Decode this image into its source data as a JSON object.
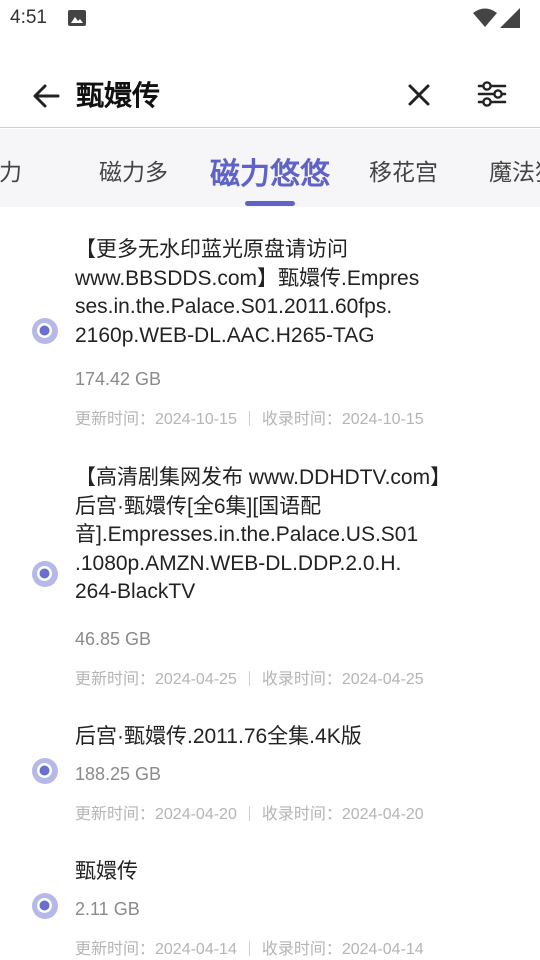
{
  "status_bar": {
    "time": "4:51"
  },
  "search": {
    "query": "甄嬛传"
  },
  "tabs": [
    {
      "label": "磁力"
    },
    {
      "label": "磁力多"
    },
    {
      "label": "磁力悠悠"
    },
    {
      "label": "移花宫"
    },
    {
      "label": "魔法猫"
    }
  ],
  "active_tab": 2,
  "accent_color": "#5f63c8",
  "results": [
    {
      "title_lines": [
        "【更多无水印蓝光原盘请访问",
        "www.BBSDDS.com】甄嬛传.Empres",
        "ses.in.the.Palace.S01.2011.60fps.",
        "2160p.WEB-DL.AAC.H265-TAG"
      ],
      "size": "174.42 GB",
      "updated": "更新时间：2024-10-15",
      "indexed": "收录时间：2024-10-15"
    },
    {
      "title_lines": [
        "【高清剧集网发布 www.DDHDTV.com】",
        "后宫·甄嬛传[全6集][国语配",
        "音].Empresses.in.the.Palace.US.S01",
        ".1080p.AMZN.WEB-DL.DDP.2.0.H.",
        "264-BlackTV"
      ],
      "size": "46.85 GB",
      "updated": "更新时间：2024-04-25",
      "indexed": "收录时间：2024-04-25"
    },
    {
      "title_lines": [
        "后宫·甄嬛传.2011.76全集.4K版"
      ],
      "size": "188.25 GB",
      "updated": "更新时间：2024-04-20",
      "indexed": "收录时间：2024-04-20"
    },
    {
      "title_lines": [
        "甄嬛传"
      ],
      "size": "2.11 GB",
      "updated": "更新时间：2024-04-14",
      "indexed": "收录时间：2024-04-14"
    }
  ]
}
